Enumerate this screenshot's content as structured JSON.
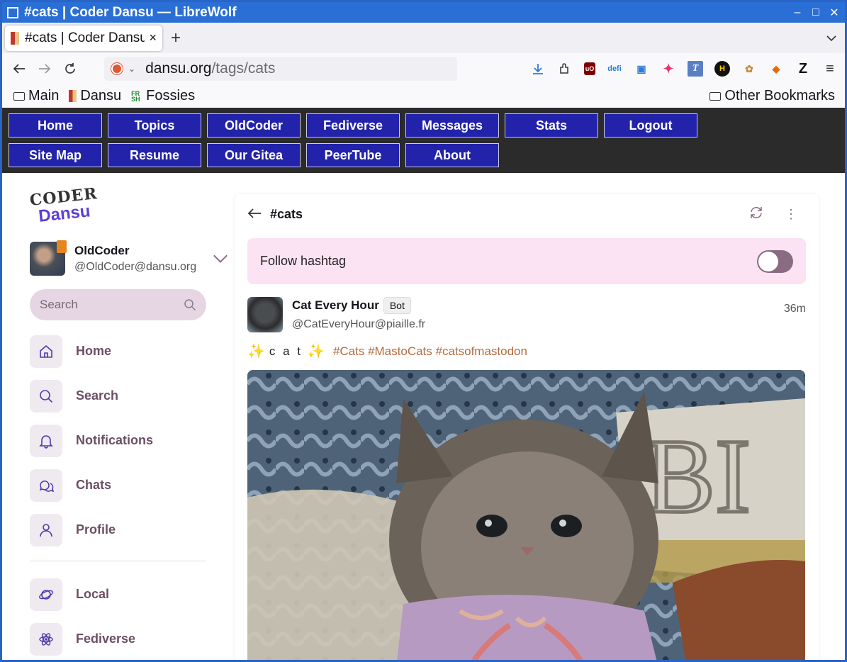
{
  "window": {
    "title": "#cats | Coder Dansu — LibreWolf"
  },
  "tabs": [
    {
      "label": "#cats | Coder Dansu"
    }
  ],
  "url": {
    "host": "dansu.org",
    "path": "/tags/cats"
  },
  "bookmarks": {
    "main": "Main",
    "dansu": "Dansu",
    "fossies": "Fossies",
    "other": "Other Bookmarks"
  },
  "site_menu": {
    "row1": [
      "Home",
      "Topics",
      "OldCoder",
      "Fediverse",
      "Messages",
      "Stats",
      "Logout"
    ],
    "row2": [
      "Site Map",
      "Resume",
      "Our Gitea",
      "PeerTube",
      "About"
    ]
  },
  "logo": {
    "line1": "CODER",
    "line2": "Dansu"
  },
  "account": {
    "name": "OldCoder",
    "handle": "@OldCoder@dansu.org"
  },
  "search": {
    "placeholder": "Search"
  },
  "sidebar": {
    "items": [
      {
        "label": "Home",
        "icon": "home-icon"
      },
      {
        "label": "Search",
        "icon": "search-icon"
      },
      {
        "label": "Notifications",
        "icon": "bell-icon"
      },
      {
        "label": "Chats",
        "icon": "chat-icon"
      },
      {
        "label": "Profile",
        "icon": "user-icon"
      }
    ],
    "feeds": [
      {
        "label": "Local",
        "icon": "planet-icon"
      },
      {
        "label": "Fediverse",
        "icon": "atom-icon"
      }
    ]
  },
  "timeline": {
    "title": "#cats",
    "follow_label": "Follow hashtag",
    "follow_enabled": false
  },
  "post": {
    "author": "Cat Every Hour",
    "badge": "Bot",
    "handle": "@CatEveryHour@piaille.fr",
    "time": "36m",
    "text": "c a t",
    "tags": "#Cats #MastoCats #catsofmastodon"
  },
  "colors": {
    "menu_button": "#2222aa",
    "accent": "#6b4f66",
    "follow_bg": "#fbe3f3",
    "titlebar": "#2a6fd6"
  }
}
